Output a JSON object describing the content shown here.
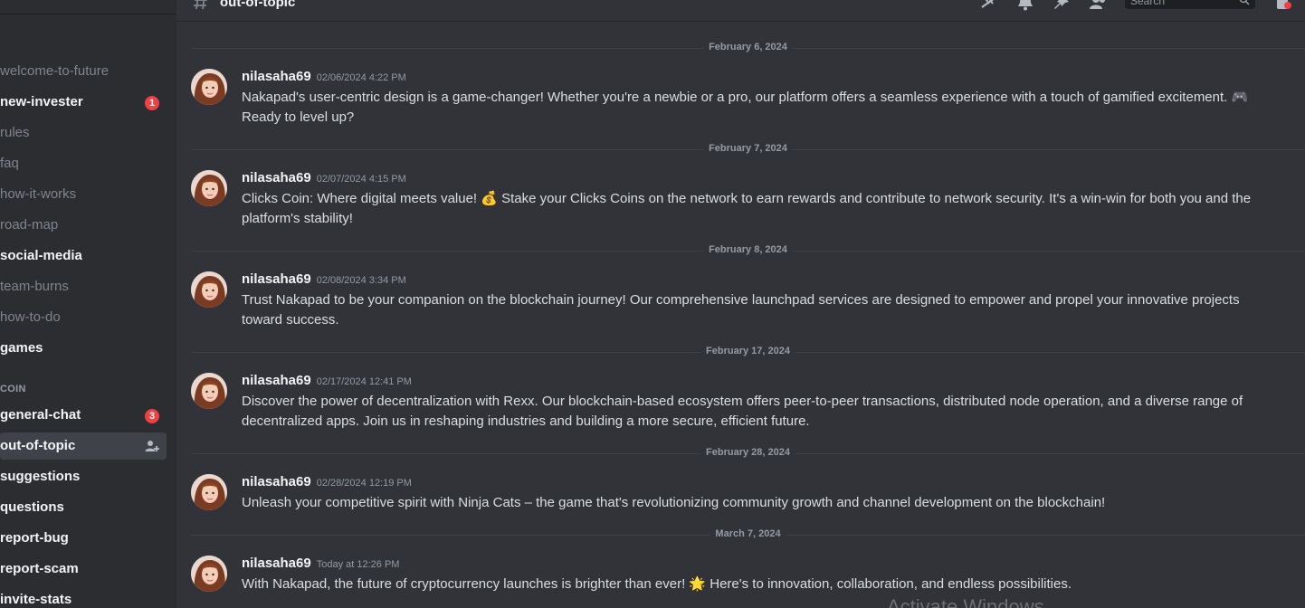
{
  "server": {
    "name": "coin"
  },
  "channel": {
    "title": "out-of-topic"
  },
  "sidebar": {
    "channels_top": [
      {
        "label": "welcome-to-future",
        "style": "muted",
        "badge": ""
      },
      {
        "label": "new-invester",
        "style": "bold",
        "badge": "1"
      },
      {
        "label": "rules",
        "style": "muted",
        "badge": ""
      },
      {
        "label": "faq",
        "style": "muted",
        "badge": ""
      },
      {
        "label": "how-it-works",
        "style": "muted",
        "badge": ""
      },
      {
        "label": "road-map",
        "style": "muted",
        "badge": ""
      },
      {
        "label": "social-media",
        "style": "bold",
        "badge": ""
      },
      {
        "label": "team-burns",
        "style": "muted",
        "badge": ""
      },
      {
        "label": "how-to-do",
        "style": "muted",
        "badge": ""
      },
      {
        "label": "games",
        "style": "bold",
        "badge": ""
      }
    ],
    "category": "COIN",
    "channels_bottom": [
      {
        "label": "general-chat",
        "style": "bold",
        "badge": "3"
      },
      {
        "label": "out-of-topic",
        "style": "selected",
        "badge": ""
      },
      {
        "label": "suggestions",
        "style": "bold",
        "badge": ""
      },
      {
        "label": "questions",
        "style": "bold",
        "badge": ""
      },
      {
        "label": "report-bug",
        "style": "bold",
        "badge": ""
      },
      {
        "label": "report-scam",
        "style": "bold",
        "badge": ""
      },
      {
        "label": "invite-stats",
        "style": "bold",
        "badge": ""
      }
    ]
  },
  "search": {
    "placeholder": "Search"
  },
  "messages": [
    {
      "date": "February 6, 2024",
      "author": "nilasaha69",
      "timestamp": "02/06/2024 4:22 PM",
      "text": "Nakapad's user-centric design is a game-changer! Whether you're a newbie or a pro, our platform offers a seamless experience with a touch of gamified excitement. 🎮 Ready to level up?"
    },
    {
      "date": "February 7, 2024",
      "author": "nilasaha69",
      "timestamp": "02/07/2024 4:15 PM",
      "text": "Clicks Coin: Where digital meets value! 💰 Stake your Clicks Coins on the network to earn rewards and contribute to network security. It's a win-win for both you and the platform's stability!"
    },
    {
      "date": "February 8, 2024",
      "author": "nilasaha69",
      "timestamp": "02/08/2024 3:34 PM",
      "text": "Trust Nakapad to be your companion on the blockchain journey! Our comprehensive launchpad services are designed to empower and propel your innovative projects toward success."
    },
    {
      "date": "February 17, 2024",
      "author": "nilasaha69",
      "timestamp": "02/17/2024 12:41 PM",
      "text": "Discover the power of decentralization with Rexx. Our blockchain-based ecosystem offers peer-to-peer transactions, distributed node operation, and a diverse range of decentralized apps. Join us in reshaping industries and building a more secure, efficient future."
    },
    {
      "date": "February 28, 2024",
      "author": "nilasaha69",
      "timestamp": "02/28/2024 12:19 PM",
      "text": "Unleash your competitive spirit with Ninja Cats – the game that's revolutionizing community growth and channel development on the blockchain!"
    },
    {
      "date": "March 7, 2024",
      "author": "nilasaha69",
      "timestamp": "Today at 12:26 PM",
      "text": "With Nakapad, the future of cryptocurrency launches is brighter than ever! 🌟 Here's to innovation, collaboration, and endless possibilities."
    }
  ],
  "watermark": "Activate Windows",
  "colors": {
    "accent_red": "#f23f43",
    "background": "#313338",
    "sidebar": "#2b2d31"
  }
}
